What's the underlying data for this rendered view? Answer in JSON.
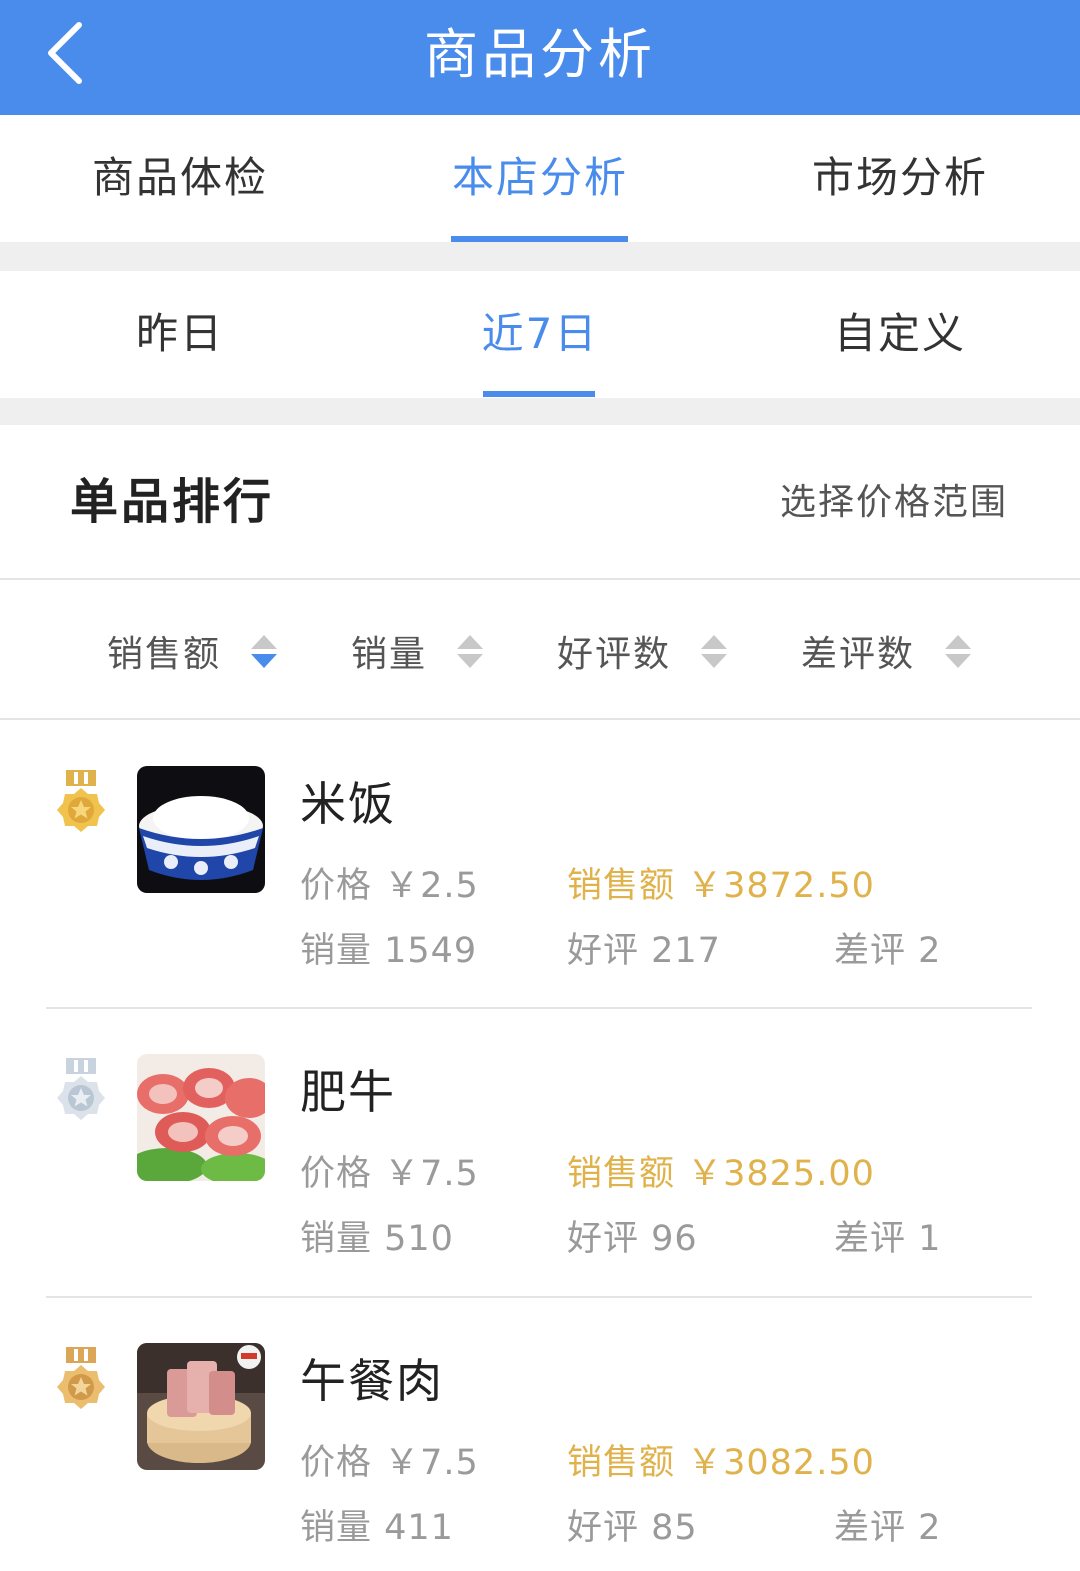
{
  "header": {
    "title": "商品分析"
  },
  "tabs": [
    {
      "label": "商品体检"
    },
    {
      "label": "本店分析"
    },
    {
      "label": "市场分析"
    }
  ],
  "periods": [
    {
      "label": "昨日"
    },
    {
      "label": "近7日"
    },
    {
      "label": "自定义"
    }
  ],
  "ranking": {
    "title": "单品排行",
    "price_range_label": "选择价格范围"
  },
  "sort_options": [
    {
      "label": "销售额"
    },
    {
      "label": "销量"
    },
    {
      "label": "好评数"
    },
    {
      "label": "差评数"
    }
  ],
  "items": [
    {
      "name": "米饭",
      "price": "价格 ￥2.5",
      "sales_amount": "销售额 ￥3872.50",
      "sales_qty": "销量 1549",
      "good_reviews": "好评 217",
      "bad_reviews": "差评 2"
    },
    {
      "name": "肥牛",
      "price": "价格 ￥7.5",
      "sales_amount": "销售额 ￥3825.00",
      "sales_qty": "销量 510",
      "good_reviews": "好评 96",
      "bad_reviews": "差评 1"
    },
    {
      "name": "午餐肉",
      "price": "价格 ￥7.5",
      "sales_amount": "销售额 ￥3082.50",
      "sales_qty": "销量 411",
      "good_reviews": "好评 85",
      "bad_reviews": "差评 2"
    }
  ],
  "colors": {
    "accent": "#4a8cec",
    "gold": "#e0b24c",
    "silver": "#c9d3df"
  }
}
